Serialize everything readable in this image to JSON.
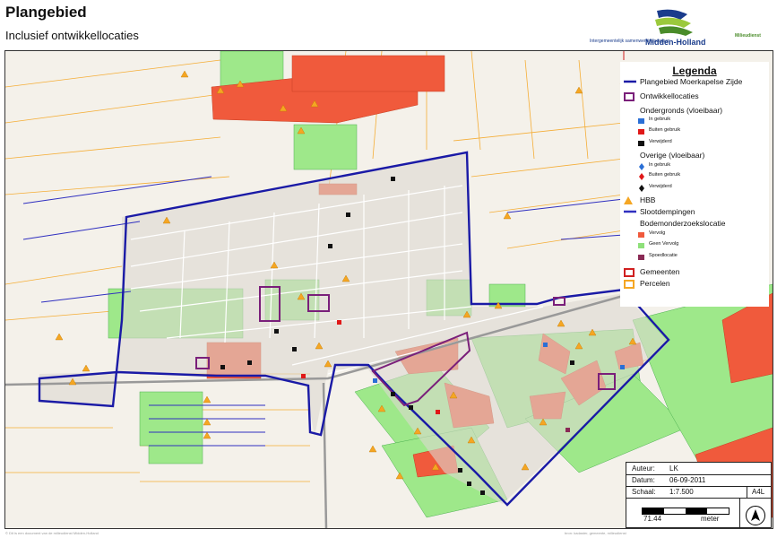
{
  "title": "Plangebied",
  "subtitle": "Inclusief ontwikkellocaties",
  "logo": {
    "small_text": "Intergemeentelijk samenwerkingsorgaan",
    "main_text": "Midden-Holland",
    "green_text": "Milieudienst",
    "colors": [
      "#1a3c8c",
      "#4a8c2a",
      "#9bc93c"
    ]
  },
  "legend": {
    "title": "Legenda",
    "items": [
      {
        "label": "Plangebied Moerkapelse Zijde",
        "symbol": "line",
        "color": "#1a1aa6"
      },
      {
        "label": "Ontwikkellocaties",
        "symbol": "square-outline",
        "color": "#7a1f7a"
      },
      {
        "label": "Ondergronds (vloeibaar)",
        "symbol": "header"
      },
      {
        "label": "In gebruik",
        "symbol": "square",
        "color": "#2a6fd6",
        "small": true
      },
      {
        "label": "Buiten gebruik",
        "symbol": "square",
        "color": "#e01818",
        "small": true
      },
      {
        "label": "Verwijderd",
        "symbol": "square",
        "color": "#111111",
        "small": true
      },
      {
        "label": "Overige (vloeibaar)",
        "symbol": "header"
      },
      {
        "label": "In gebruik",
        "symbol": "diamond",
        "color": "#2a6fd6",
        "small": true
      },
      {
        "label": "Buiten gebruik",
        "symbol": "diamond",
        "color": "#e01818",
        "small": true
      },
      {
        "label": "Verwijderd",
        "symbol": "diamond",
        "color": "#111111",
        "small": true
      },
      {
        "label": "HBB",
        "symbol": "triangle",
        "color": "#f5a623"
      },
      {
        "label": "Slootdempingen",
        "symbol": "line",
        "color": "#3030c0"
      },
      {
        "label": "Bodemonderzoekslocatie",
        "symbol": "header"
      },
      {
        "label": "Vervolg",
        "symbol": "square-fill",
        "color": "#f05a3c",
        "small": true
      },
      {
        "label": "Geen Vervolg",
        "symbol": "square-fill",
        "color": "#8ee07a",
        "small": true
      },
      {
        "label": "Spoedlocatie",
        "symbol": "square-fill",
        "color": "#8a2a55",
        "small": true
      },
      {
        "label": "Gemeenten",
        "symbol": "square-outline",
        "color": "#d02020"
      },
      {
        "label": "Percelen",
        "symbol": "square-outline",
        "color": "#f5a623"
      }
    ]
  },
  "info": {
    "author_label": "Auteur:",
    "author": "LK",
    "date_label": "Datum:",
    "date": "06-09-2011",
    "scale_label": "Schaal:",
    "scale": "1:7.500",
    "paper": "A4L"
  },
  "scalebar": {
    "value": "71.44",
    "unit": "meter"
  },
  "north_arrow": {
    "icon": "north-arrow-icon",
    "letter": "A"
  },
  "footer": {
    "left": "© Dit is een document van de milieudienst Midden-Holland",
    "right": "bron: kadaster, gemeente, milieudienst"
  },
  "colors": {
    "boundary": "#1a1aa6",
    "development": "#7a1f7a",
    "parcel_line": "#f5a623",
    "followup": "#f05a3c",
    "no_followup": "#9ee88a",
    "urgent": "#8a2a55",
    "background": "#f2f0ea"
  }
}
